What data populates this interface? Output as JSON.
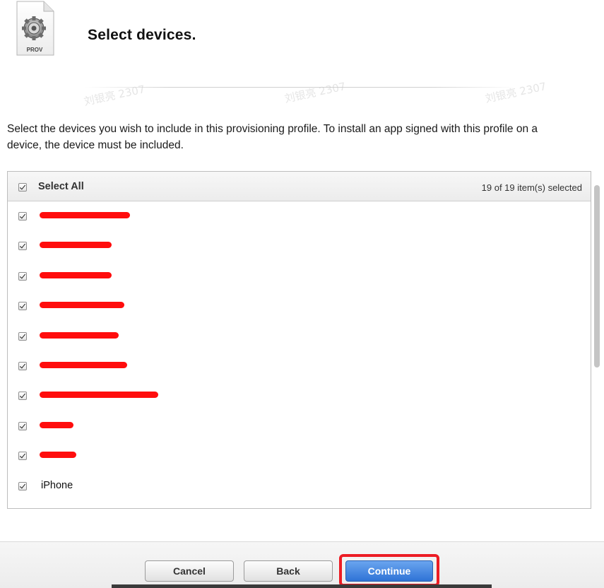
{
  "header": {
    "file_icon_label": "PROV",
    "title": "Select devices."
  },
  "instructions": "Select the devices you wish to include in this provisioning profile. To install an app signed with this profile on a device, the device must be included.",
  "device_list": {
    "select_all_label": "Select All",
    "selected_count": "19 of 19 item(s) selected",
    "rows": [
      {
        "name": "",
        "redacted": true,
        "redaction_width": 128,
        "checked": true
      },
      {
        "name": "",
        "redacted": true,
        "redaction_width": 102,
        "checked": true
      },
      {
        "name": "",
        "redacted": true,
        "redaction_width": 102,
        "checked": true
      },
      {
        "name": "",
        "redacted": true,
        "redaction_width": 120,
        "checked": true
      },
      {
        "name": "",
        "redacted": true,
        "redaction_width": 112,
        "checked": true
      },
      {
        "name": "",
        "redacted": true,
        "redaction_width": 124,
        "checked": true
      },
      {
        "name": "",
        "redacted": true,
        "redaction_width": 168,
        "checked": true
      },
      {
        "name": "",
        "redacted": true,
        "redaction_width": 48,
        "checked": true
      },
      {
        "name": "",
        "redacted": true,
        "redaction_width": 52,
        "checked": true
      },
      {
        "name": "iPhone",
        "redacted": false,
        "redaction_width": 0,
        "checked": true
      }
    ]
  },
  "footer": {
    "cancel_label": "Cancel",
    "back_label": "Back",
    "continue_label": "Continue"
  },
  "colors": {
    "redaction": "#ff0d0d",
    "highlight": "#ec1c24",
    "primary_button": "#2f73d6"
  },
  "icons": {
    "file_icon": "gear-document-icon",
    "checkbox": "checkmark-icon"
  },
  "watermark_text": "刘银亮 2307"
}
